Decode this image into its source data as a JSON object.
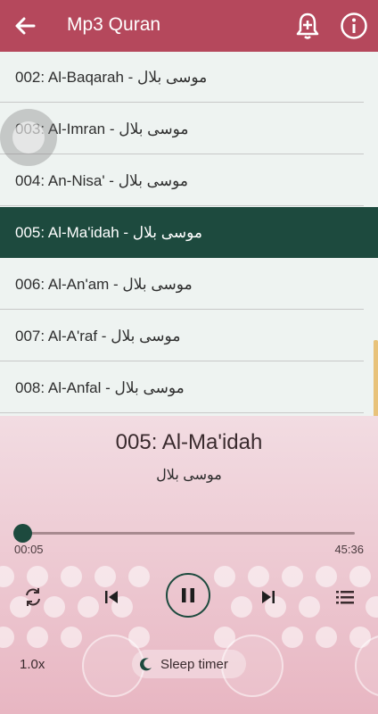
{
  "appbar": {
    "title": "Mp3 Quran",
    "back_icon": "arrow-left-icon",
    "alarm_icon": "bell-plus-icon",
    "info_icon": "info-icon",
    "background": "#b5485c"
  },
  "list": {
    "items": [
      {
        "label": "002: Al-Baqarah - موسى بلال",
        "selected": false
      },
      {
        "label": "003: Al-Imran - موسى بلال",
        "selected": false
      },
      {
        "label": "004: An-Nisa' - موسى بلال",
        "selected": false
      },
      {
        "label": "005: Al-Ma'idah - موسى بلال",
        "selected": true
      },
      {
        "label": "006: Al-An'am - موسى بلال",
        "selected": false
      },
      {
        "label": "007: Al-A'raf - موسى بلال",
        "selected": false
      },
      {
        "label": "008: Al-Anfal - موسى بلال",
        "selected": false
      }
    ],
    "selected_color": "#1d4a3e"
  },
  "player": {
    "title": "005: Al-Ma'idah",
    "artist": "موسى بلال",
    "current_time": "00:05",
    "total_time": "45:36",
    "progress": 0.002,
    "speed": "1.0x",
    "sleep_timer": "Sleep timer",
    "icons": [
      "repeat-icon",
      "previous-icon",
      "pause-icon",
      "next-icon",
      "playlist-icon",
      "moon-icon"
    ]
  }
}
